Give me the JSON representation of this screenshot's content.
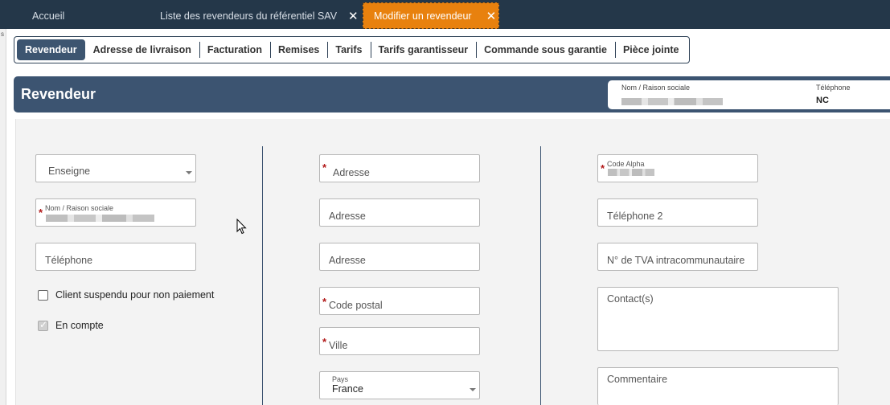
{
  "top_tabs": [
    {
      "label": "Accueil"
    },
    {
      "label": "Liste des revendeurs du référentiel SAV",
      "close": "✕"
    },
    {
      "label": "Modifier un revendeur",
      "close": "✕"
    }
  ],
  "sub_tabs": [
    "Revendeur",
    "Adresse de livraison",
    "Facturation",
    "Remises",
    "Tarifs",
    "Tarifs garantisseur",
    "Commande sous garantie",
    "Pièce jointe"
  ],
  "banner": {
    "title": "Revendeur",
    "name_label": "Nom / Raison sociale",
    "phone_label": "Téléphone",
    "phone_value": "NC"
  },
  "col1": {
    "enseigne_placeholder": "Enseigne",
    "nom_label": "Nom / Raison sociale",
    "telephone_placeholder": "Téléphone",
    "suspendu_label": "Client suspendu pour non paiement",
    "suspendu_checked": false,
    "en_compte_label": "En compte",
    "en_compte_checked": true
  },
  "col2": {
    "adresse1_placeholder": "Adresse",
    "adresse2_placeholder": "Adresse",
    "adresse3_placeholder": "Adresse",
    "code_postal_placeholder": "Code postal",
    "ville_placeholder": "Ville",
    "pays_label": "Pays",
    "pays_value": "France"
  },
  "col3": {
    "code_alpha_label": "Code Alpha",
    "telephone2_placeholder": "Téléphone 2",
    "tva_placeholder": "N° de TVA intracommunautaire",
    "contacts_placeholder": "Contact(s)",
    "commentaire_placeholder": "Commentaire"
  },
  "required_marker": "*",
  "left_edge_char": "s",
  "colors": {
    "header": "#243749",
    "active_tab": "#e8810e",
    "banner": "#3c5471",
    "required": "#b11717"
  },
  "icons": [
    "close-icon",
    "dropdown-caret-icon",
    "checkbox-icon",
    "mouse-cursor-icon"
  ]
}
